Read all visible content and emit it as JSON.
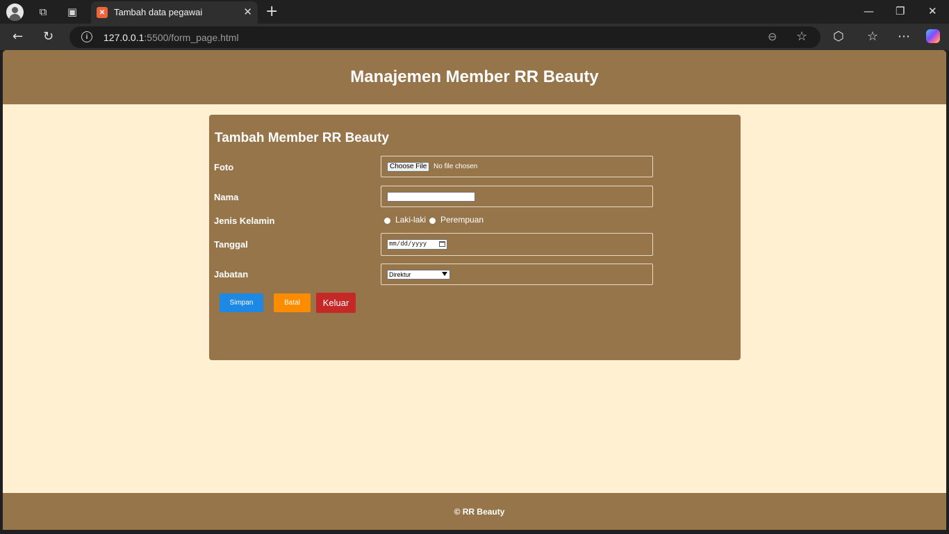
{
  "browser": {
    "tab": {
      "title": "Tambah data pegawai",
      "favicon": "xampp-icon"
    },
    "address": {
      "host": "127.0.0.1",
      "rest": ":5500/form_page.html"
    }
  },
  "page": {
    "header_title": "Manajemen Member RR Beauty",
    "form": {
      "title": "Tambah Member RR Beauty",
      "foto": {
        "label": "Foto",
        "button": "Choose File",
        "status": "No file chosen"
      },
      "nama": {
        "label": "Nama",
        "value": ""
      },
      "jenis_kelamin": {
        "label": "Jenis Kelamin",
        "options": [
          "Laki-laki",
          "Perempuan"
        ]
      },
      "tanggal": {
        "label": "Tanggal",
        "placeholder": "mm/dd/yyyy"
      },
      "jabatan": {
        "label": "Jabatan",
        "selected": "Direktur"
      },
      "buttons": {
        "simpan": "Simpan",
        "batal": "Batal",
        "keluar": "Keluar"
      }
    },
    "footer": "© RR Beauty"
  },
  "colors": {
    "brown": "#97754b",
    "cream": "#fff0d1",
    "save": "#1e88e5",
    "cancel": "#fb8c00",
    "exit": "#c62828"
  }
}
